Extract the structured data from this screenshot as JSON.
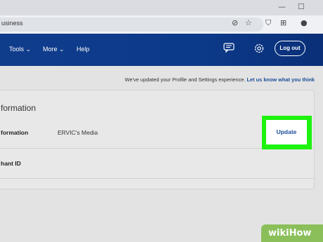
{
  "browser": {
    "url_text": "usiness",
    "window_controls": [
      "minimize-icon",
      "maximize-icon"
    ]
  },
  "navbar": {
    "items": [
      {
        "label": "Tools",
        "has_dropdown": true
      },
      {
        "label": "More",
        "has_dropdown": true
      },
      {
        "label": "Help",
        "has_dropdown": false
      }
    ],
    "logout_label": "Log out",
    "icons": [
      "message-center-icon",
      "settings-icon"
    ]
  },
  "notice": {
    "text": "We've updated your Profile and Settings experience.",
    "link": "Let us know what you think"
  },
  "card": {
    "title": "formation",
    "row1_label": "formation",
    "row1_value": "ERVIC's Media",
    "update_label": "Update",
    "row2_label": "hant ID"
  },
  "watermark": "wikiHow",
  "colors": {
    "nav_bg": "#0c3a8a",
    "highlight": "#1ef20f",
    "link": "#1b4d9a"
  }
}
